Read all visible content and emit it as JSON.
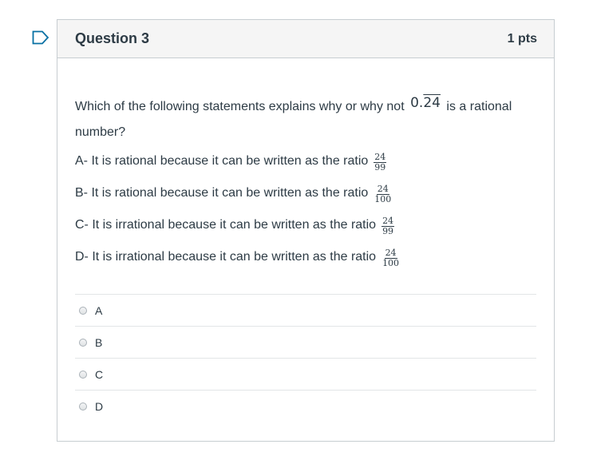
{
  "question": {
    "title": "Question 3",
    "points": "1 pts",
    "prompt_before": "Which of the following statements explains why or why not",
    "repeating_prefix": "0.",
    "repeating_digits": "24",
    "prompt_after": "is a rational number?",
    "statements": [
      {
        "text": "A- It is rational because it can be written as the ratio",
        "num": "24",
        "den": "99"
      },
      {
        "text": "B- It is rational because it can be written as the ratio",
        "num": "24",
        "den": "100"
      },
      {
        "text": "C- It is irrational because it can be written as the ratio",
        "num": "24",
        "den": "99"
      },
      {
        "text": "D- It is irrational because it can be written as the ratio",
        "num": "24",
        "den": "100"
      }
    ]
  },
  "answers": [
    {
      "label": "A",
      "selected": false
    },
    {
      "label": "B",
      "selected": false
    },
    {
      "label": "C",
      "selected": false
    },
    {
      "label": "D",
      "selected": false
    }
  ],
  "colors": {
    "text": "#2d3b45",
    "header_bg": "#f5f5f5",
    "border": "#c7cdd1",
    "flag": "#0770a3"
  }
}
